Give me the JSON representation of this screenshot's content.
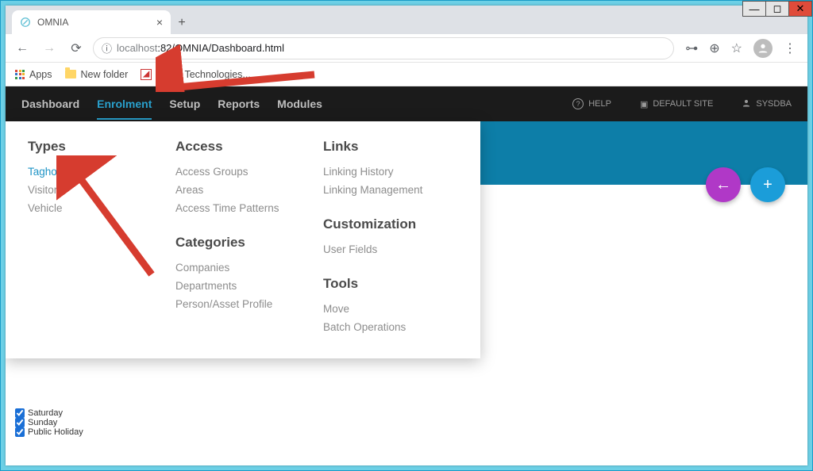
{
  "window": {
    "minimize": "—",
    "maximize": "◻",
    "close": "✕"
  },
  "browser": {
    "tab_title": "OMNIA",
    "tab_close": "×",
    "new_tab": "+",
    "nav_back": "←",
    "nav_forward": "→",
    "nav_reload": "⟳",
    "url_scheme_icon": "ⓘ",
    "url_host": "localhost",
    "url_port_path": ":82/OMNIA/Dashboard.html",
    "key_icon": "⊶",
    "zoom_icon": "⊕",
    "star_icon": "☆",
    "menu_icon": "⋮"
  },
  "bookmarks": {
    "apps": "Apps",
    "new_folder": "New folder",
    "impro": "Impro Technologies...",
    "impro_glyph": "◢"
  },
  "nav": {
    "items": [
      "Dashboard",
      "Enrolment",
      "Setup",
      "Reports",
      "Modules"
    ],
    "help": "HELP",
    "help_icon": "?",
    "site_icon": "▣",
    "site": "DEFAULT SITE",
    "user_icon": "👤",
    "user": "SYSDBA"
  },
  "mega": {
    "col1_header": "Types",
    "col1_items": [
      "Tagholders",
      "Visitor",
      "Vehicle"
    ],
    "col2_header_a": "Access",
    "col2_items_a": [
      "Access Groups",
      "Areas",
      "Access Time Patterns"
    ],
    "col2_header_b": "Categories",
    "col2_items_b": [
      "Companies",
      "Departments",
      "Person/Asset Profile"
    ],
    "col3_header_a": "Links",
    "col3_items_a": [
      "Linking History",
      "Linking Management"
    ],
    "col3_header_b": "Customization",
    "col3_items_b": [
      "User Fields"
    ],
    "col3_header_c": "Tools",
    "col3_items_c": [
      "Move",
      "Batch Operations"
    ]
  },
  "fab": {
    "back": "←",
    "add": "+"
  },
  "days": {
    "items": [
      "Saturday",
      "Sunday",
      "Public Holiday"
    ]
  }
}
